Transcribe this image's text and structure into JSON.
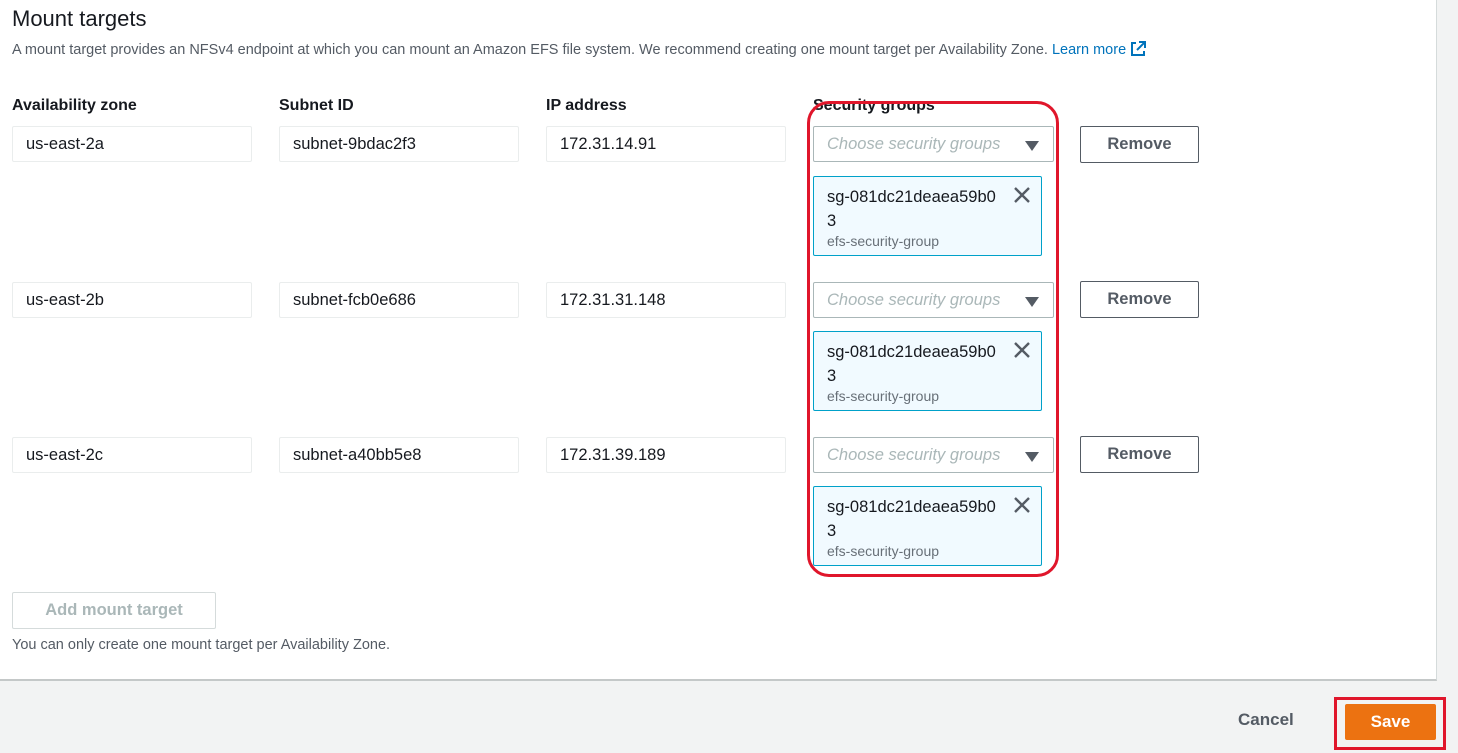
{
  "section": {
    "title": "Mount targets",
    "description": "A mount target provides an NFSv4 endpoint at which you can mount an Amazon EFS file system. We recommend creating one mount target per Availability Zone.",
    "learn_more": "Learn more"
  },
  "columns": {
    "availability_zone": "Availability zone",
    "subnet_id": "Subnet ID",
    "ip_address": "IP address",
    "security_groups": "Security groups"
  },
  "rows": [
    {
      "az": "us-east-2a",
      "subnet": "subnet-9bdac2f3",
      "ip": "172.31.14.91",
      "sg_placeholder": "Choose security groups",
      "sg_token_id": "sg-081dc21deaea59b03",
      "sg_token_name": "efs-security-group",
      "remove_label": "Remove"
    },
    {
      "az": "us-east-2b",
      "subnet": "subnet-fcb0e686",
      "ip": "172.31.31.148",
      "sg_placeholder": "Choose security groups",
      "sg_token_id": "sg-081dc21deaea59b03",
      "sg_token_name": "efs-security-group",
      "remove_label": "Remove"
    },
    {
      "az": "us-east-2c",
      "subnet": "subnet-a40bb5e8",
      "ip": "172.31.39.189",
      "sg_placeholder": "Choose security groups",
      "sg_token_id": "sg-081dc21deaea59b03",
      "sg_token_name": "efs-security-group",
      "remove_label": "Remove"
    }
  ],
  "add_mount_target": "Add mount target",
  "hint": "You can only create one mount target per Availability Zone.",
  "footer": {
    "cancel": "Cancel",
    "save": "Save"
  },
  "colors": {
    "accent_orange": "#ec7211",
    "link_blue": "#0073bb",
    "highlight_red": "#e0162b",
    "token_bg": "#f1faff",
    "token_border": "#00a1c9"
  }
}
